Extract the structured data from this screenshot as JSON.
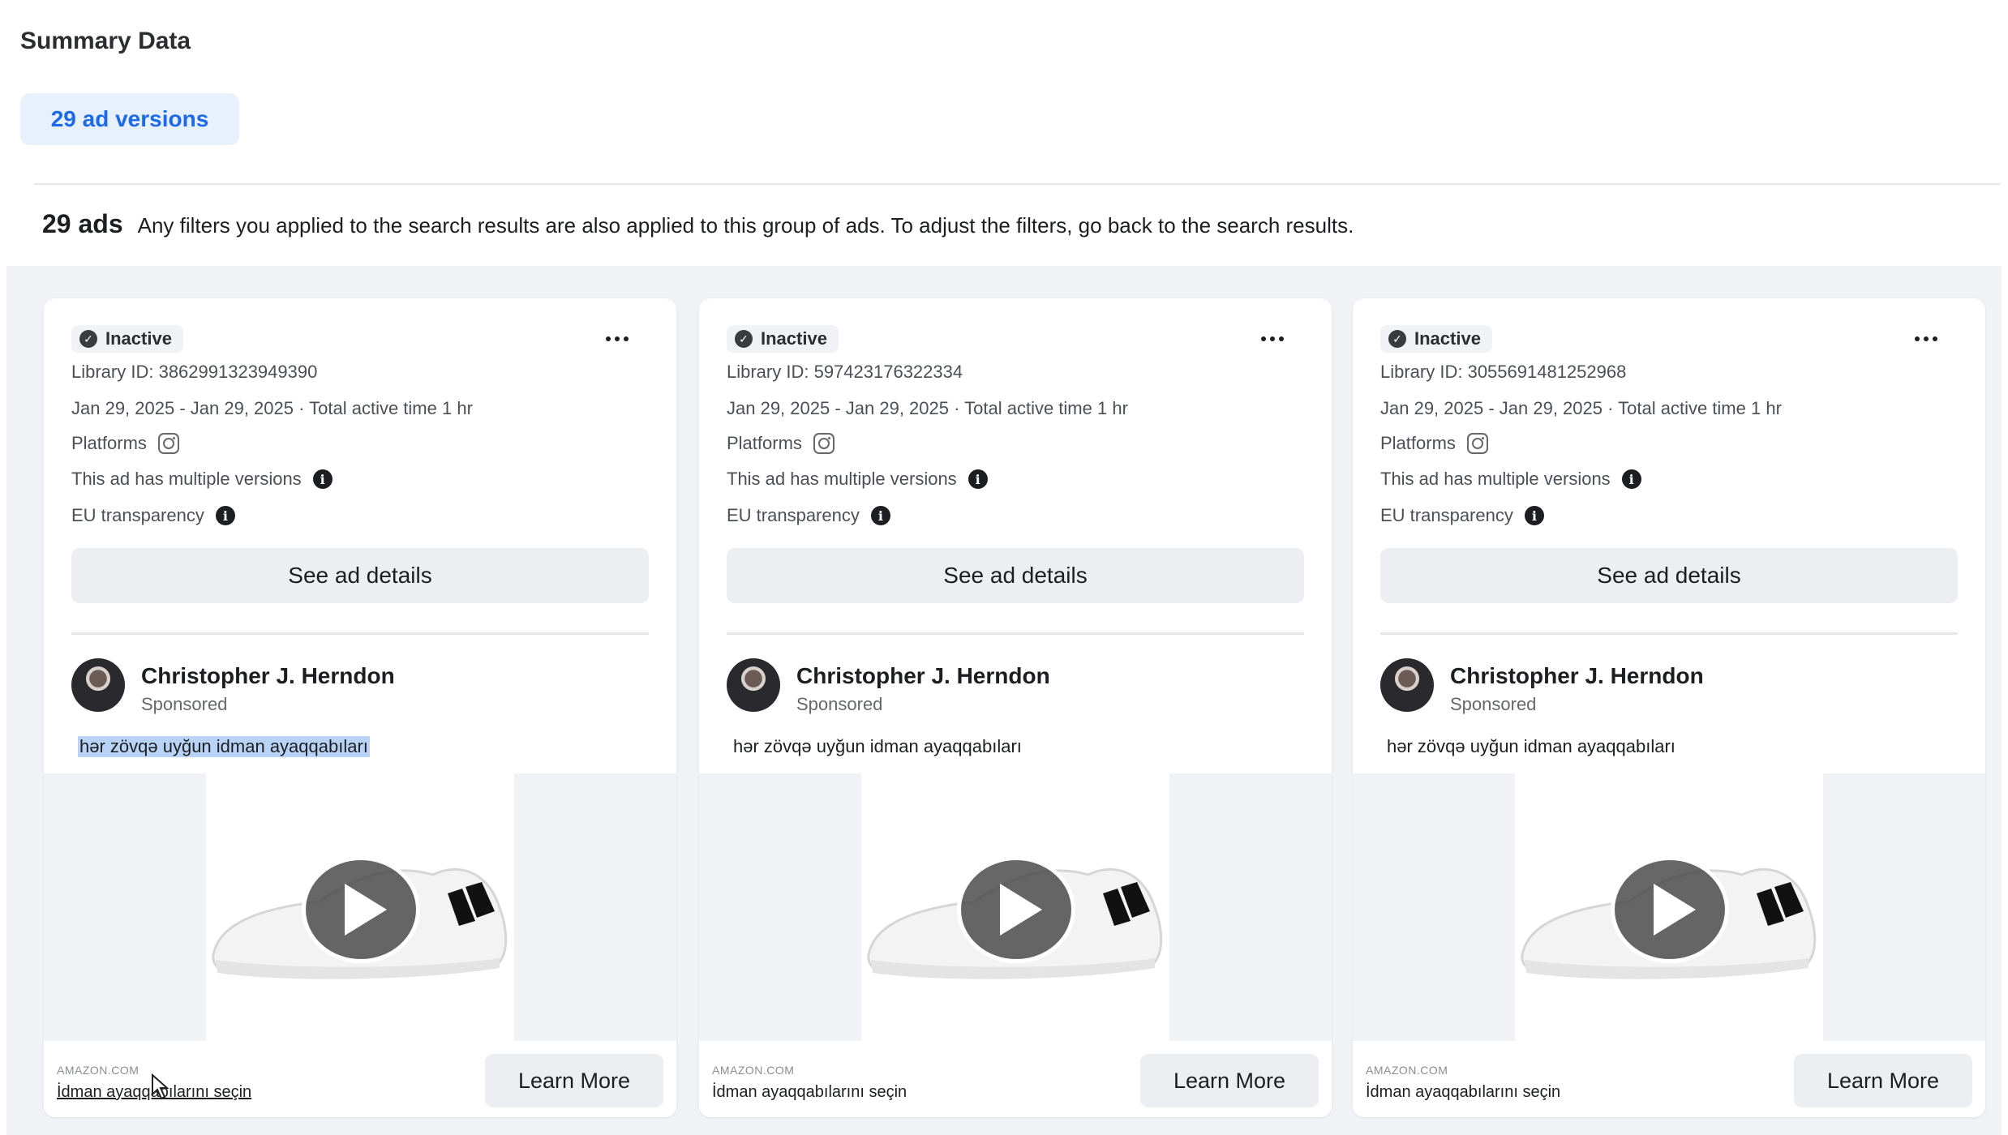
{
  "summary": {
    "title": "Summary Data",
    "versions_chip": "29 ad versions",
    "ads_count": "29 ads",
    "ads_note": "Any filters you applied to the search results are also applied to this group of ads. To adjust the filters, go back to the search results."
  },
  "cards": [
    {
      "status": "Inactive",
      "library_id": "Library ID: 3862991323949390",
      "dates": "Jan 29, 2025 - Jan 29, 2025 · Total active time 1 hr",
      "platforms_label": "Platforms",
      "multiple_versions": "This ad has multiple versions",
      "eu_transparency": "EU transparency",
      "details_button": "See ad details",
      "advertiser": "Christopher J. Herndon",
      "sponsored": "Sponsored",
      "ad_text": "hər zövqə uyğun idman ayaqqabıları",
      "cta_domain": "AMAZON.COM",
      "cta_title": "İdman ayaqqabılarını seçin",
      "cta_button": "Learn More"
    },
    {
      "status": "Inactive",
      "library_id": "Library ID: 597423176322334",
      "dates": "Jan 29, 2025 - Jan 29, 2025 · Total active time 1 hr",
      "platforms_label": "Platforms",
      "multiple_versions": "This ad has multiple versions",
      "eu_transparency": "EU transparency",
      "details_button": "See ad details",
      "advertiser": "Christopher J. Herndon",
      "sponsored": "Sponsored",
      "ad_text": "hər zövqə uyğun idman ayaqqabıları",
      "cta_domain": "AMAZON.COM",
      "cta_title": "İdman ayaqqabılarını seçin",
      "cta_button": "Learn More"
    },
    {
      "status": "Inactive",
      "library_id": "Library ID: 3055691481252968",
      "dates": "Jan 29, 2025 - Jan 29, 2025 · Total active time 1 hr",
      "platforms_label": "Platforms",
      "multiple_versions": "This ad has multiple versions",
      "eu_transparency": "EU transparency",
      "details_button": "See ad details",
      "advertiser": "Christopher J. Herndon",
      "sponsored": "Sponsored",
      "ad_text": "hər zövqə uyğun idman ayaqqabıları",
      "cta_domain": "AMAZON.COM",
      "cta_title": "İdman ayaqqabılarını seçin",
      "cta_button": "Learn More"
    }
  ],
  "icons": {
    "status": "check-circle-icon",
    "more": "more-horizontal-icon",
    "platform": "instagram-icon",
    "info": "info-icon",
    "play": "play-icon"
  },
  "colors": {
    "chip_bg": "#e7f0fd",
    "chip_text": "#1d6ae5",
    "grid_bg": "#f0f2f5",
    "text_highlight": "#b8d3f6"
  }
}
